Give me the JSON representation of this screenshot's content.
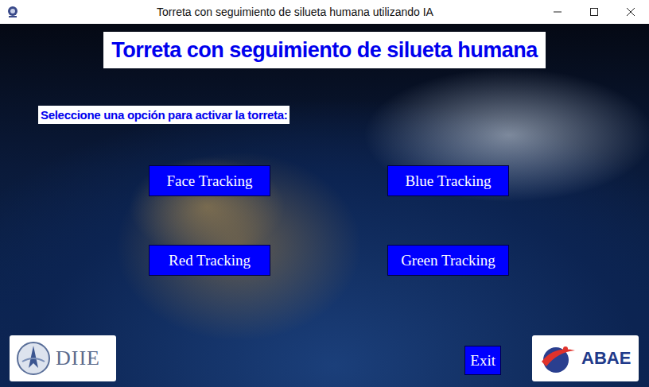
{
  "window": {
    "title": "Torreta con seguimiento de silueta humana utilizando IA"
  },
  "header": {
    "title": "Torreta con seguimiento de silueta humana"
  },
  "prompt": "Seleccione una opción para activar la torreta:",
  "options": [
    {
      "label": "Face Tracking"
    },
    {
      "label": "Blue Tracking"
    },
    {
      "label": "Red Tracking"
    },
    {
      "label": "Green Tracking"
    }
  ],
  "exit_button": "Exit",
  "logos": [
    {
      "name": "DIIE"
    },
    {
      "name": "ABAE"
    }
  ]
}
